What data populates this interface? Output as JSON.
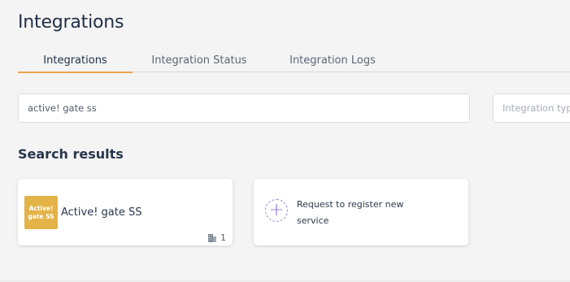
{
  "page": {
    "title": "Integrations"
  },
  "tabs": [
    {
      "label": "Integrations",
      "active": true
    },
    {
      "label": "Integration Status",
      "active": false
    },
    {
      "label": "Integration Logs",
      "active": false
    }
  ],
  "search": {
    "value": "active! gate ss",
    "placeholder": ""
  },
  "type_filter": {
    "placeholder": "Integration type"
  },
  "results": {
    "title": "Search results",
    "items": [
      {
        "name": "Active! gate SS",
        "logo_text": "Active!\ngate SS",
        "count": "1",
        "count_icon": "building-icon",
        "logo_color": "#e3b348"
      }
    ],
    "request_card": {
      "label": "Request to register new service",
      "icon": "plus-circle-icon",
      "icon_color": "#8c70d2"
    }
  },
  "colors": {
    "active_tab_underline": "#f0a14c",
    "page_background": "#f4f4f4"
  }
}
